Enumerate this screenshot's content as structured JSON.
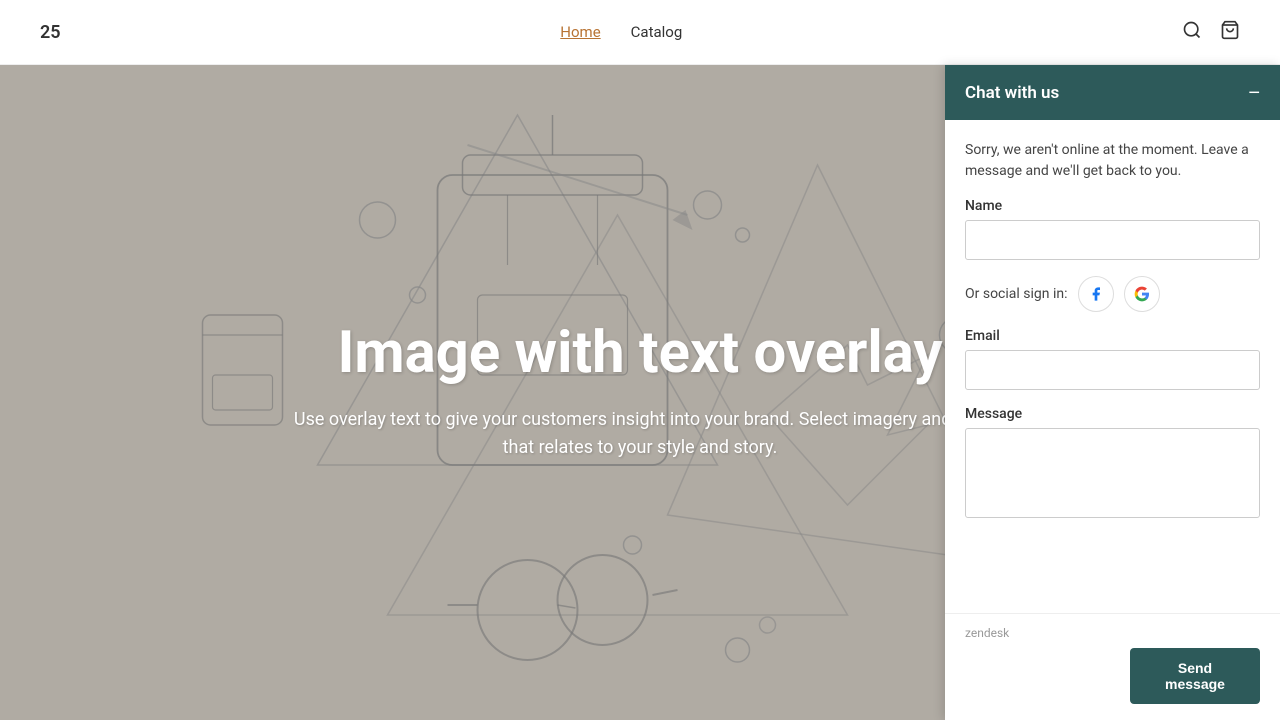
{
  "brand": "25",
  "nav": {
    "links": [
      {
        "label": "Home",
        "active": true
      },
      {
        "label": "Catalog",
        "active": false
      }
    ]
  },
  "hero": {
    "title": "Image with text overlay",
    "subtitle": "Use overlay text to give your customers insight into your brand. Select imagery and text that relates to your style and story."
  },
  "chat": {
    "header_title": "Chat with us",
    "minimize_label": "−",
    "offline_message": "Sorry, we aren't online at the moment. Leave a message and we'll get back to you.",
    "name_label": "Name",
    "name_placeholder": "",
    "social_label": "Or social sign in:",
    "email_label": "Email",
    "email_placeholder": "",
    "message_label": "Message",
    "message_placeholder": "",
    "send_button_label": "Send message",
    "powered_by": "zendesk"
  },
  "colors": {
    "chat_header_bg": "#2d5a5a",
    "send_btn_bg": "#2d5a5a",
    "nav_bg": "#ffffff",
    "hero_bg": "#b0aba3"
  }
}
